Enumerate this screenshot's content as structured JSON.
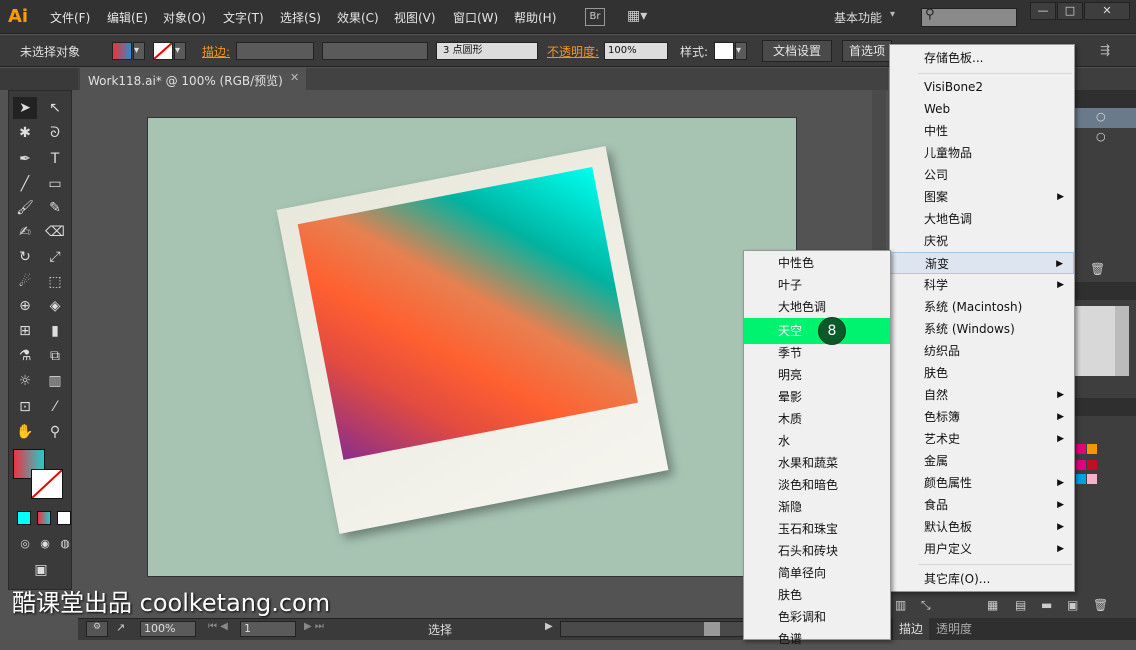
{
  "app": {
    "logo": "Ai"
  },
  "menubar": {
    "items": [
      "文件(F)",
      "编辑(E)",
      "对象(O)",
      "文字(T)",
      "选择(S)",
      "效果(C)",
      "视图(V)",
      "窗口(W)",
      "帮助(H)"
    ],
    "br": "Br",
    "workspace": "基本功能",
    "window_buttons": [
      "—",
      "□",
      "✕"
    ]
  },
  "controlbar": {
    "no_selection": "未选择对象",
    "stroke_label": "描边:",
    "brush": "3 点圆形",
    "opacity_label": "不透明度:",
    "opacity_value": "100%",
    "style_label": "样式:",
    "doc_settings": "文档设置",
    "prefs": "首选项"
  },
  "tab": {
    "title": "Work118.ai* @ 100% (RGB/预览)",
    "close": "✕"
  },
  "status": {
    "zoom": "100%",
    "page": "1",
    "tool": "选择"
  },
  "right_panel": {
    "stroke_tab": "描边",
    "transparency_tab": "透明度"
  },
  "main_menu": {
    "items": [
      {
        "label": "存储色板...",
        "arrow": false
      },
      {
        "label": "VisiBone2",
        "arrow": false
      },
      {
        "label": "Web",
        "arrow": false
      },
      {
        "label": "中性",
        "arrow": false
      },
      {
        "label": "儿童物品",
        "arrow": false
      },
      {
        "label": "公司",
        "arrow": false
      },
      {
        "label": "图案",
        "arrow": true
      },
      {
        "label": "大地色调",
        "arrow": false
      },
      {
        "label": "庆祝",
        "arrow": false
      },
      {
        "label": "渐变",
        "arrow": true
      },
      {
        "label": "科学",
        "arrow": true
      },
      {
        "label": "系统 (Macintosh)",
        "arrow": false
      },
      {
        "label": "系统 (Windows)",
        "arrow": false
      },
      {
        "label": "纺织品",
        "arrow": false
      },
      {
        "label": "肤色",
        "arrow": false
      },
      {
        "label": "自然",
        "arrow": true
      },
      {
        "label": "色标簿",
        "arrow": true
      },
      {
        "label": "艺术史",
        "arrow": true
      },
      {
        "label": "金属",
        "arrow": false
      },
      {
        "label": "颜色属性",
        "arrow": true
      },
      {
        "label": "食品",
        "arrow": true
      },
      {
        "label": "默认色板",
        "arrow": true
      },
      {
        "label": "用户定义",
        "arrow": true
      },
      {
        "label": "其它库(O)...",
        "arrow": false
      }
    ]
  },
  "sub_menu": {
    "items": [
      "中性色",
      "叶子",
      "大地色调",
      "天空",
      "季节",
      "明亮",
      "晕影",
      "木质",
      "水",
      "水果和蔬菜",
      "淡色和暗色",
      "渐隐",
      "玉石和珠宝",
      "石头和砖块",
      "简单径向",
      "肤色",
      "色彩调和",
      "色谱"
    ],
    "highlighted": "天空"
  },
  "step_badge": "8",
  "watermark": "酷课堂出品 coolketang.com",
  "colors": {
    "highlight": "#00f36e",
    "badge": "#0c5a2a",
    "accent_orange": "#f7941d",
    "artboard": "#a7c4b3"
  }
}
